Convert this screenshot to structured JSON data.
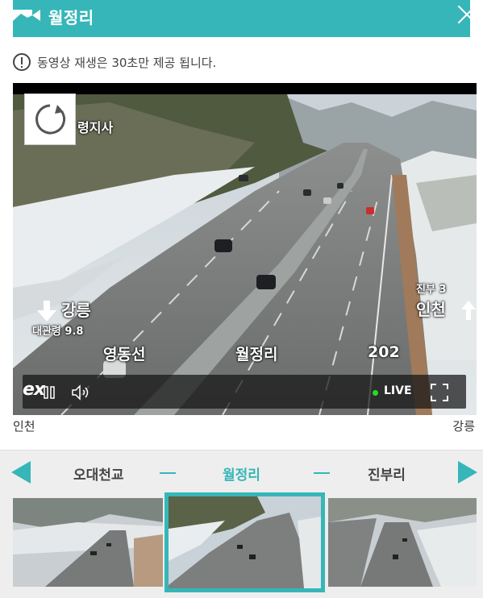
{
  "header": {
    "title": "월정리",
    "close_label": ""
  },
  "notice": {
    "text": "동영상 재생은 30초만 제공 됩니다."
  },
  "video": {
    "overlay": {
      "top_left": "령지사",
      "left_direction": "강릉",
      "left_distance": "대관령 9.8",
      "right_direction_small": "진부 3",
      "right_direction": "인천",
      "line": "영동선",
      "location": "월정리",
      "km": "202"
    },
    "controls": {
      "brand": "ex",
      "live_label": "LIVE"
    }
  },
  "directions": {
    "left": "인천",
    "right": "강릉"
  },
  "navigation": {
    "prev": "오대천교",
    "current": "월정리",
    "next": "진부리"
  },
  "colors": {
    "accent": "#36b6b8",
    "live": "#22dd22"
  }
}
